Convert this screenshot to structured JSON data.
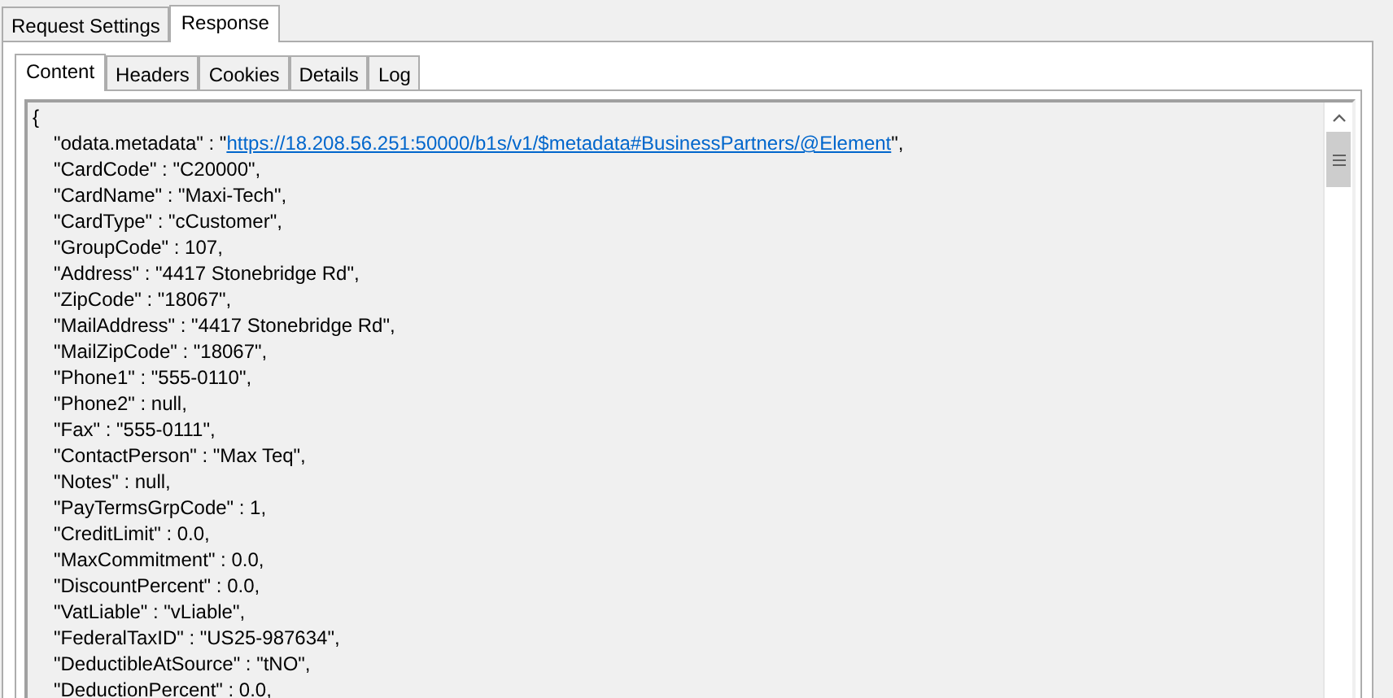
{
  "tabs": [
    {
      "label": "Request Settings",
      "selected": false
    },
    {
      "label": "Response",
      "selected": true
    }
  ],
  "subtabs": [
    {
      "label": "Content",
      "selected": true
    },
    {
      "label": "Headers",
      "selected": false
    },
    {
      "label": "Cookies",
      "selected": false
    },
    {
      "label": "Details",
      "selected": false
    },
    {
      "label": "Log",
      "selected": false
    }
  ],
  "content": {
    "open_brace": "{",
    "lines": [
      {
        "kind": "link",
        "before": "\"odata.metadata\" : \"",
        "link": "https://18.208.56.251:50000/b1s/v1/$metadata#BusinessPartners/@Element",
        "after": "\","
      },
      {
        "kind": "plain",
        "text": "\"CardCode\" : \"C20000\","
      },
      {
        "kind": "plain",
        "text": "\"CardName\" : \"Maxi-Tech\","
      },
      {
        "kind": "plain",
        "text": "\"CardType\" : \"cCustomer\","
      },
      {
        "kind": "plain",
        "text": "\"GroupCode\" : 107,"
      },
      {
        "kind": "plain",
        "text": "\"Address\" : \"4417 Stonebridge Rd\","
      },
      {
        "kind": "plain",
        "text": "\"ZipCode\" : \"18067\","
      },
      {
        "kind": "plain",
        "text": "\"MailAddress\" : \"4417 Stonebridge Rd\","
      },
      {
        "kind": "plain",
        "text": "\"MailZipCode\" : \"18067\","
      },
      {
        "kind": "plain",
        "text": "\"Phone1\" : \"555-0110\","
      },
      {
        "kind": "plain",
        "text": "\"Phone2\" : null,"
      },
      {
        "kind": "plain",
        "text": "\"Fax\" : \"555-0111\","
      },
      {
        "kind": "plain",
        "text": "\"ContactPerson\" : \"Max Teq\","
      },
      {
        "kind": "plain",
        "text": "\"Notes\" : null,"
      },
      {
        "kind": "plain",
        "text": "\"PayTermsGrpCode\" : 1,"
      },
      {
        "kind": "plain",
        "text": "\"CreditLimit\" : 0.0,"
      },
      {
        "kind": "plain",
        "text": "\"MaxCommitment\" : 0.0,"
      },
      {
        "kind": "plain",
        "text": "\"DiscountPercent\" : 0.0,"
      },
      {
        "kind": "plain",
        "text": "\"VatLiable\" : \"vLiable\","
      },
      {
        "kind": "plain",
        "text": "\"FederalTaxID\" : \"US25-987634\","
      },
      {
        "kind": "plain",
        "text": "\"DeductibleAtSource\" : \"tNO\","
      },
      {
        "kind": "plain",
        "text": "\"DeductionPercent\" : 0.0,"
      }
    ]
  }
}
